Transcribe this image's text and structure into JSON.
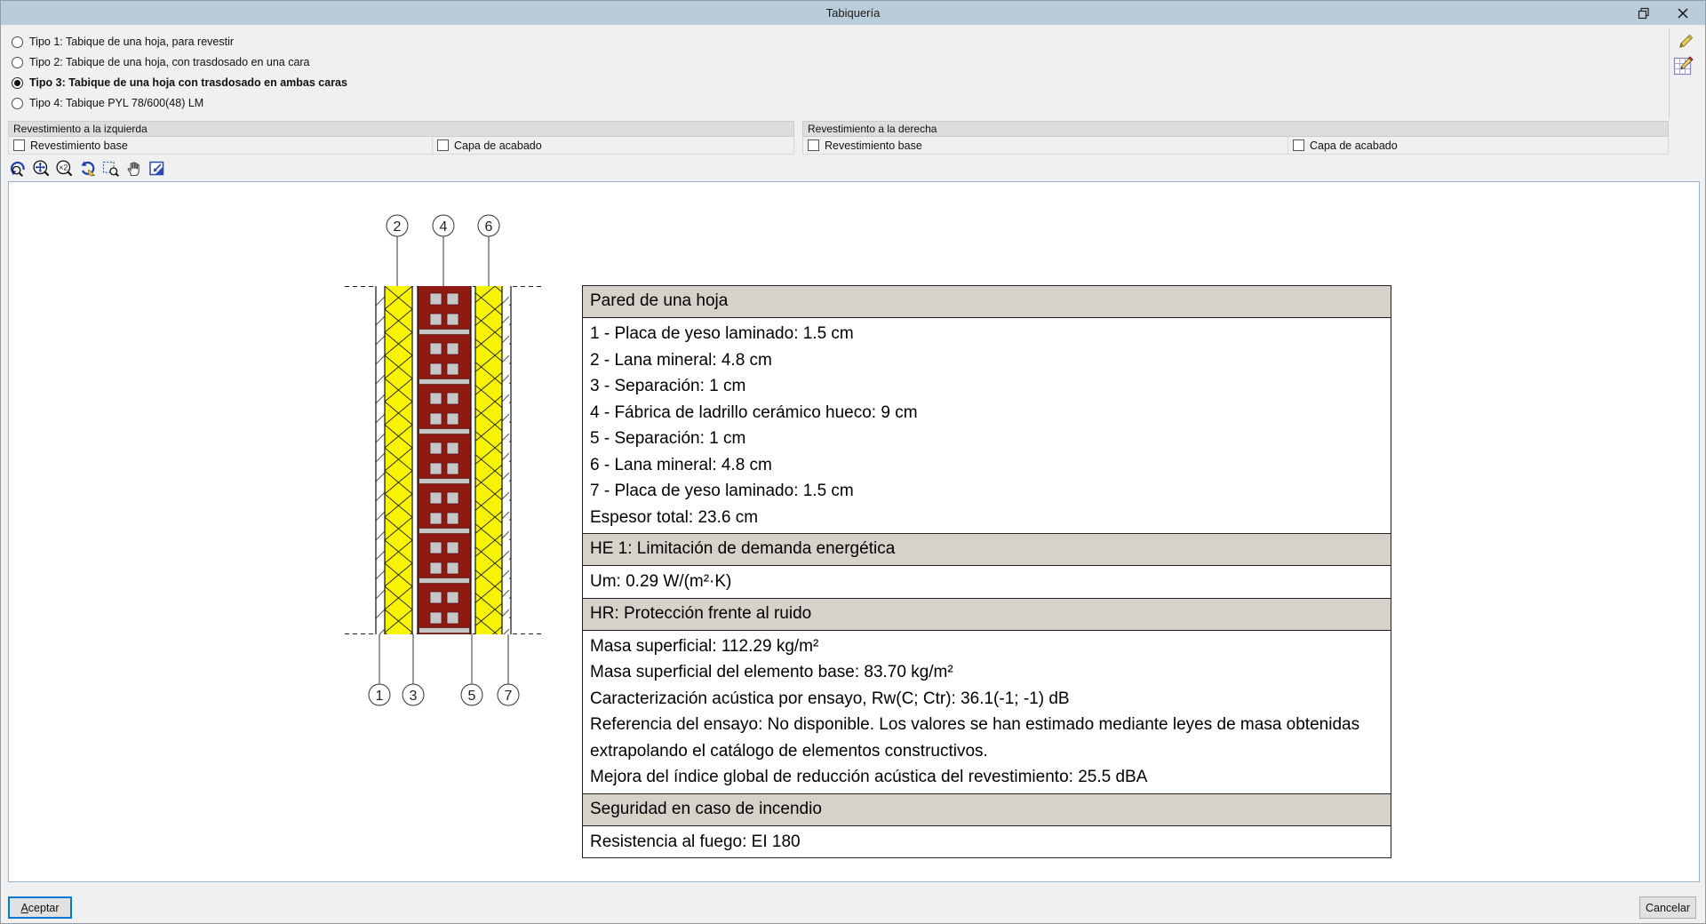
{
  "window": {
    "title": "Tabiquería"
  },
  "types": {
    "options": [
      {
        "label": "Tipo 1: Tabique de una hoja, para revestir",
        "selected": false
      },
      {
        "label": "Tipo 2: Tabique de una hoja, con trasdosado en una cara",
        "selected": false
      },
      {
        "label": "Tipo 3: Tabique de una hoja con trasdosado en ambas caras",
        "selected": true
      },
      {
        "label": "Tipo 4: Tabique PYL 78/600(48) LM",
        "selected": false
      }
    ]
  },
  "panels": {
    "left": {
      "title": "Revestimiento a la izquierda",
      "base_label": "Revestimiento base",
      "base_checked": false,
      "finish_label": "Capa de acabado",
      "finish_checked": false
    },
    "right": {
      "title": "Revestimiento a la derecha",
      "base_label": "Revestimiento base",
      "base_checked": false,
      "finish_label": "Capa de acabado",
      "finish_checked": false
    }
  },
  "toolbar": {
    "icons": [
      "zoom-refresh",
      "zoom-extents",
      "zoom-x2",
      "redraw",
      "zoom-window",
      "pan-hand",
      "previous-view"
    ]
  },
  "diagram": {
    "top_markers": [
      "2",
      "4",
      "6"
    ],
    "bottom_markers": [
      "1",
      "3",
      "5",
      "7"
    ]
  },
  "wall_table": {
    "pared_title": "Pared de una hoja",
    "pared_rows": [
      "1 - Placa de yeso laminado: 1.5 cm",
      "2 - Lana mineral: 4.8 cm",
      "3 - Separación: 1 cm",
      "4 - Fábrica de ladrillo cerámico hueco: 9 cm",
      "5 - Separación: 1 cm",
      "6 - Lana mineral: 4.8 cm",
      "7 - Placa de yeso laminado: 1.5 cm",
      "Espesor total: 23.6 cm"
    ],
    "he_title": "HE 1: Limitación de demanda energética",
    "he_rows": [
      "Um: 0.29 W/(m²·K)"
    ],
    "hr_title": "HR: Protección frente al ruido",
    "hr_rows": [
      "Masa superficial: 112.29 kg/m²",
      "Masa superficial del elemento base: 83.70 kg/m²",
      "Caracterización acústica por ensayo, Rw(C; Ctr): 36.1(-1; -1) dB",
      "Referencia del ensayo: No disponible. Los valores se han estimado mediante leyes de masa obtenidas extrapolando el catálogo de elementos constructivos.",
      "Mejora del índice global de reducción acústica del revestimiento: 25.5 dBA"
    ],
    "fuego_title": "Seguridad en caso de incendio",
    "fuego_rows": [
      "Resistencia al fuego: EI 180"
    ]
  },
  "footer": {
    "accept_key": "A",
    "accept_rest": "ceptar",
    "cancel": "Cancelar"
  },
  "colors": {
    "titlebar": "#b8ccd9",
    "table_header_bg": "#d6d2c9",
    "brick_red": "#8e1a12",
    "wool_yellow": "#f8f400",
    "mortar_gray": "#c6c6c6",
    "focus_blue": "#0078d7"
  }
}
